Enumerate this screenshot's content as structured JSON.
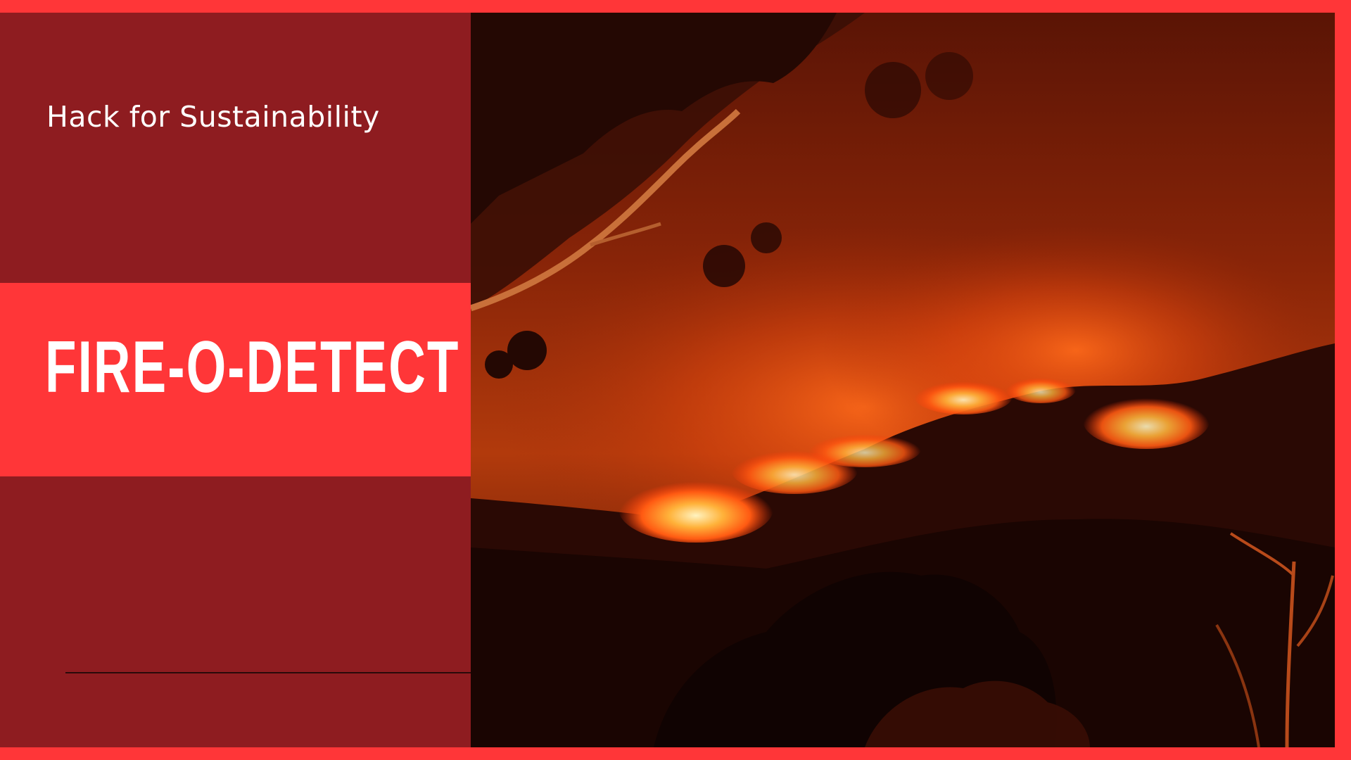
{
  "slide": {
    "subtitle": "Hack for Sustainability",
    "title": "FIRE-O-DETECT"
  },
  "colors": {
    "background_accent": "#ff3638",
    "panel_dark": "#8e1c20",
    "text": "#ffffff"
  },
  "image": {
    "icon": "wildfire-night-photo"
  }
}
